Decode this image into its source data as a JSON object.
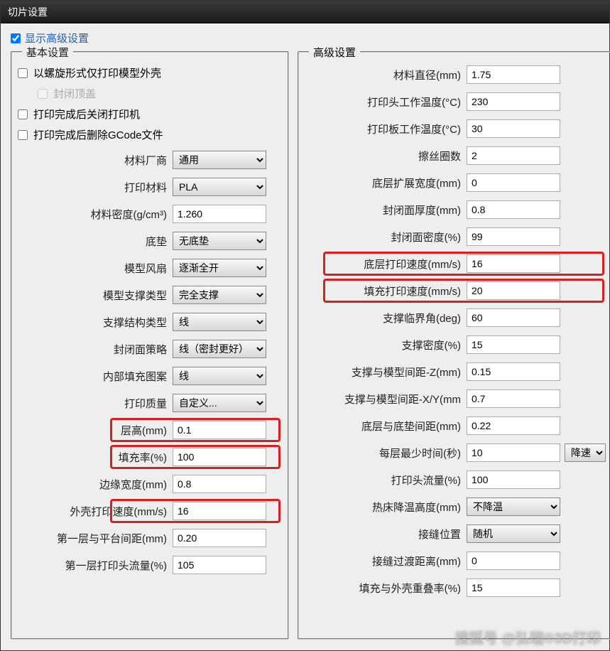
{
  "title": "切片设置",
  "showAdvancedLabel": "显示高级设置",
  "basic": {
    "legend": "基本设置",
    "spiralLabel": "以螺旋形式仅打印模型外壳",
    "sealTopLabel": "封闭顶盖",
    "powerOffLabel": "打印完成后关闭打印机",
    "deleteGcodeLabel": "打印完成后删除GCode文件",
    "rows": {
      "vendor": {
        "label": "材料厂商",
        "value": "通用"
      },
      "material": {
        "label": "打印材料",
        "value": "PLA"
      },
      "density": {
        "label": "材料密度(g/cm³)",
        "value": "1.260"
      },
      "raft": {
        "label": "底垫",
        "value": "无底垫"
      },
      "fan": {
        "label": "模型风扇",
        "value": "逐渐全开"
      },
      "support": {
        "label": "模型支撑类型",
        "value": "完全支撑"
      },
      "supportStruct": {
        "label": "支撑结构类型",
        "value": "线"
      },
      "sealStrategy": {
        "label": "封闭面策略",
        "value": "线（密封更好）"
      },
      "infillPattern": {
        "label": "内部填充图案",
        "value": "线"
      },
      "quality": {
        "label": "打印质量",
        "value": "自定义..."
      },
      "layerHeight": {
        "label": "层高(mm)",
        "value": "0.1"
      },
      "infillRate": {
        "label": "填充率(%)",
        "value": "100"
      },
      "edgeWidth": {
        "label": "边缘宽度(mm)",
        "value": "0.8"
      },
      "shellSpeed": {
        "label": "外壳打印速度(mm/s)",
        "value": "16"
      },
      "firstGap": {
        "label": "第一层与平台间距(mm)",
        "value": "0.20"
      },
      "firstFlow": {
        "label": "第一层打印头流量(%)",
        "value": "105"
      }
    }
  },
  "advanced": {
    "legend": "高级设置",
    "rows": {
      "diameter": {
        "label": "材料直径(mm)",
        "value": "1.75"
      },
      "headTemp": {
        "label": "打印头工作温度(°C)",
        "value": "230"
      },
      "bedTemp": {
        "label": "打印板工作温度(°C)",
        "value": "30"
      },
      "wipe": {
        "label": "擦丝圈数",
        "value": "2"
      },
      "baseExpand": {
        "label": "底层扩展宽度(mm)",
        "value": "0"
      },
      "sealThick": {
        "label": "封闭面厚度(mm)",
        "value": "0.8"
      },
      "sealDensity": {
        "label": "封闭面密度(%)",
        "value": "99"
      },
      "baseSpeed": {
        "label": "底层打印速度(mm/s)",
        "value": "16"
      },
      "infillSpeed": {
        "label": "填充打印速度(mm/s)",
        "value": "20"
      },
      "supportAngle": {
        "label": "支撑临界角(deg)",
        "value": "60"
      },
      "supportDensity": {
        "label": "支撑密度(%)",
        "value": "15"
      },
      "supportGapZ": {
        "label": "支撑与模型间距-Z(mm)",
        "value": "0.15"
      },
      "supportGapXY": {
        "label": "支撑与模型间距-X/Y(mm",
        "value": "0.7"
      },
      "raftGap": {
        "label": "底层与底垫间距(mm)",
        "value": "0.22"
      },
      "minLayerTime": {
        "label": "每层最少时间(秒)",
        "value": "10",
        "mode": "降速"
      },
      "headFlow": {
        "label": "打印头流量(%)",
        "value": "100"
      },
      "bedCool": {
        "label": "热床降温高度(mm)",
        "value": "不降温"
      },
      "seamPos": {
        "label": "接缝位置",
        "value": "随机"
      },
      "seamDist": {
        "label": "接缝过渡距离(mm)",
        "value": "0"
      },
      "infillOverlap": {
        "label": "填充与外壳重叠率(%)",
        "value": "15"
      }
    }
  },
  "watermark": "搜狐号 @弘瑞®3D打印"
}
